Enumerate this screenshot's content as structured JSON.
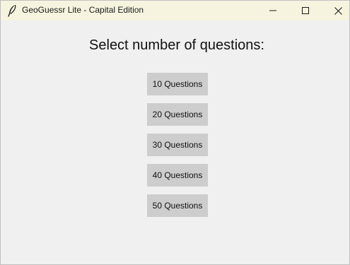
{
  "window": {
    "title": "GeoGuessr Lite - Capital Edition",
    "controls": {
      "minimize_icon": "minimize-icon",
      "maximize_icon": "maximize-icon",
      "close_icon": "close-icon"
    }
  },
  "main": {
    "heading": "Select number of questions:",
    "options": [
      {
        "label": "10 Questions"
      },
      {
        "label": "20 Questions"
      },
      {
        "label": "30 Questions"
      },
      {
        "label": "40 Questions"
      },
      {
        "label": "50 Questions"
      }
    ]
  },
  "colors": {
    "titlebar_bg": "#f6f4df",
    "window_bg": "#f0f0f0",
    "button_bg": "#cdcdcd"
  }
}
